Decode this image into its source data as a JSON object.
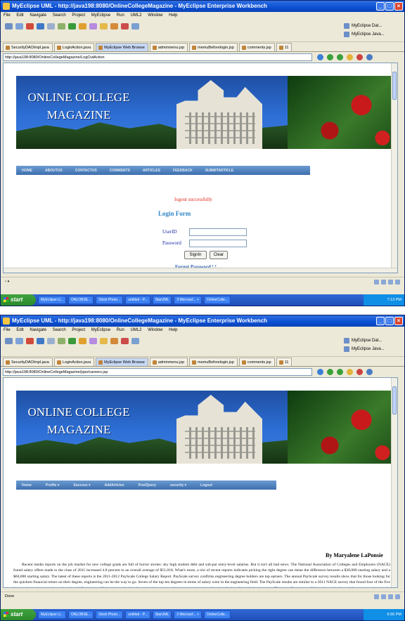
{
  "screen1": {
    "title": "MyEclipse UML - http://java198:8080/OnlineCollegeMagazine - MyEclipse Enterprise Workbench",
    "menu": [
      "File",
      "Edit",
      "Navigate",
      "Search",
      "Project",
      "MyEclipse",
      "Run",
      "UML2",
      "Window",
      "Help"
    ],
    "perspectives": [
      "MyEclipse Dat...",
      "MyEclipse Java..."
    ],
    "tabs": [
      "SecurityDAOImpl.java",
      "LoginAction.java",
      "MyEclipse Web Browse",
      "adminmenu.jsp",
      "memuBeforelogin.jsp",
      "comments.jsp",
      "11"
    ],
    "url": "http://java198:8080/OnlineCollegeMagazine/LogOutAction",
    "banner_title": [
      "ONLINE COLLEGE",
      "MAGAZINE"
    ],
    "nav": [
      "HOME",
      "ABOUTUS",
      "CONTACTUS",
      "COMMENTS",
      "ARTICLES",
      "FEEDBACK",
      "SUBMITARTICLE"
    ],
    "logout_message": "logout successfully",
    "login_title": "Login Form",
    "userid_label": "UserID",
    "password_label": "Password",
    "signin_label": "SignIn",
    "clear_label": "Clear",
    "forgot_label": "Forgot Password ! ! ....",
    "taskbar": [
      "MyEclipse U...",
      "ONLOBSE...",
      "Slock Photo...",
      "untitled - P...",
      "StarUML",
      "3 Microsof... +",
      "OnlineColle..."
    ],
    "start": "start",
    "clock": "7:13 PM"
  },
  "screen2": {
    "title": "MyEclipse UML - http://java198:8080/OnlineCollegeMagazine - MyEclipse Enterprise Workbench",
    "menu": [
      "File",
      "Edit",
      "Navigate",
      "Search",
      "Project",
      "MyEclipse",
      "Run",
      "UML2",
      "Window",
      "Help"
    ],
    "perspectives": [
      "MyEclipse Dat...",
      "MyEclipse Java..."
    ],
    "tabs": [
      "SecurityDAOImpl.java",
      "LoginAction.java",
      "MyEclipse Web Browse",
      "adminmenu.jsp",
      "memuBeforelogin.jsp",
      "comments.jsp",
      "11"
    ],
    "url": "http://java198:8080/OnlineCollegeMagazine/jsps/careers.jsp",
    "banner_title": [
      "ONLINE COLLEGE",
      "MAGAZINE"
    ],
    "nav": [
      "Home",
      "Profile ▾",
      "Success ▾",
      "AddArticles",
      "PostQuery",
      "security ▾",
      "Logout"
    ],
    "author": "By Maryalene LaPonsie",
    "article": "Recent media reports on the job market for new college grads are full of horror stories: sky high student debt and sub-par entry-level salaries. But it isn't all bad news. The National Association of Colleges and Employers (NACE) found salary offers made to the class of 2011 increased 4.8 percent to an overall average of $51,018. What's more, a trio of recent reports indicates picking the right degree can mean the difference between a $30,000 starting salary and a $60,000 starting salary. The latest of these reports is the 2011-2012 PayScale College Salary Report. PayScale survey confirms engineering degree holders are top earners. The annual PayScale survey results show that for those looking for the quickest financial return on their degree, engineering can be the way to go. Seven of the top ten degrees in terms of salary were in the engineering field. The PayScale results are similar to a 2011 NACE survey that found four of the five best paying majors were in engineering. A Georgetown University study that the spring also gave top honors to engineering when it ranked median salaries by major. The same Georgetown University study showed that many students in the top-earning majors went on to work within their fields, suggesting a tight link between the major learning, degree programs and practical employment opportunities. Two dollar degrees according to PayScale PayScale collected data from",
    "status": "Done",
    "taskbar": [
      "MyEclipse U...",
      "ONLOBSE...",
      "Slock Photo...",
      "untitled - P...",
      "StarUML",
      "2 Microsof... +",
      "OnlineColle..."
    ],
    "start": "start",
    "clock": "6:56 PM"
  }
}
